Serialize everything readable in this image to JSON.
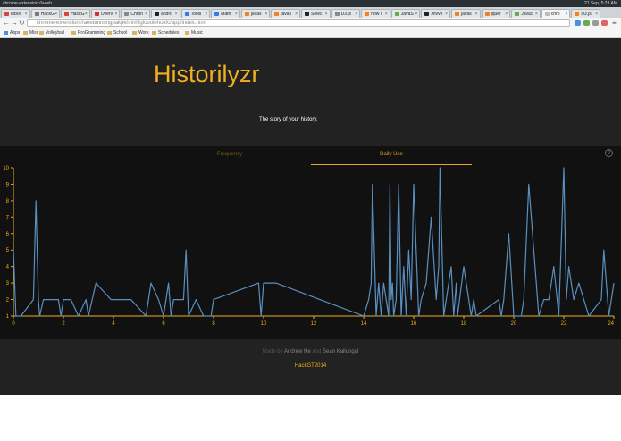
{
  "os": {
    "window_title": "chrome-extension://aeeb...",
    "clock": "21 Sep, 5:23 AM"
  },
  "browser": {
    "tabs": [
      {
        "label": "Inbox",
        "color": "#d44638",
        "active": false
      },
      {
        "label": "HackG",
        "color": "#777777",
        "active": false
      },
      {
        "label": "HackG",
        "color": "#d44638",
        "active": false
      },
      {
        "label": "Overv",
        "color": "#cc3333",
        "active": false
      },
      {
        "label": "Chron",
        "color": "#888888",
        "active": false
      },
      {
        "label": "andro",
        "color": "#222222",
        "active": false
      },
      {
        "label": "Tools",
        "color": "#3b78e7",
        "active": false
      },
      {
        "label": "Math",
        "color": "#3b78e7",
        "active": false
      },
      {
        "label": "javas",
        "color": "#f48024",
        "active": false
      },
      {
        "label": "javas",
        "color": "#f48024",
        "active": false
      },
      {
        "label": "Selec",
        "color": "#222222",
        "active": false
      },
      {
        "label": "D3.js",
        "color": "#888888",
        "active": false
      },
      {
        "label": "how i",
        "color": "#f48024",
        "active": false
      },
      {
        "label": "JavaS",
        "color": "#6aa84f",
        "active": false
      },
      {
        "label": "Jnvve",
        "color": "#222222",
        "active": false
      },
      {
        "label": "javas",
        "color": "#f48024",
        "active": false
      },
      {
        "label": "jquer",
        "color": "#f48024",
        "active": false
      },
      {
        "label": "JavaS",
        "color": "#6aa84f",
        "active": false
      },
      {
        "label": "chro",
        "color": "#bbbbbb",
        "active": true
      },
      {
        "label": "D3.js",
        "color": "#f48024",
        "active": false
      }
    ],
    "url": "chrome-extension://aeebmnnngpakpkhhhhfglooolehcofc/app/index.html",
    "bookmarks": [
      "Apps",
      "Misc",
      "Volleyball",
      "ProGramming",
      "School",
      "Work",
      "Schedules",
      "Music"
    ]
  },
  "app": {
    "title": "Historilyzr",
    "tagline": "The story of your history.",
    "tabs": {
      "frequency": "Frequency",
      "daily": "Daily Use"
    },
    "help": "?"
  },
  "footer": {
    "made_by": "Made by",
    "author1": "Andrew He",
    "and": "and",
    "author2": "Sean Kallungal",
    "event": "HackGT2014"
  },
  "chart_data": {
    "type": "line",
    "xlim": [
      0,
      24
    ],
    "ylim": [
      1,
      10
    ],
    "xticks": [
      0,
      2,
      4,
      6,
      8,
      10,
      12,
      14,
      16,
      18,
      20,
      22,
      24
    ],
    "yticks": [
      1,
      2,
      3,
      4,
      5,
      6,
      7,
      8,
      9,
      10
    ],
    "line_color": "#5a8fc0",
    "axis_color": "#f0b020",
    "x": [
      0,
      0.1,
      0.3,
      0.8,
      0.9,
      1.0,
      1.05,
      1.2,
      1.8,
      1.9,
      2.0,
      2.3,
      2.6,
      2.9,
      3.0,
      3.3,
      3.9,
      4.7,
      5.3,
      5.5,
      5.8,
      6.0,
      6.2,
      6.3,
      6.4,
      6.8,
      6.9,
      7.0,
      7.3,
      7.6,
      7.9,
      8.0,
      9.8,
      9.9,
      10.0,
      10.5,
      14.0,
      14.2,
      14.3,
      14.35,
      14.5,
      14.6,
      14.7,
      14.8,
      14.9,
      15.0,
      15.05,
      15.1,
      15.15,
      15.2,
      15.3,
      15.4,
      15.5,
      15.6,
      15.7,
      15.8,
      15.9,
      16.0,
      16.2,
      16.3,
      16.5,
      16.7,
      16.9,
      17.0,
      17.05,
      17.2,
      17.3,
      17.5,
      17.6,
      17.7,
      17.75,
      18.0,
      18.3,
      18.4,
      18.5,
      19.4,
      19.5,
      19.6,
      19.8,
      20.0,
      20.3,
      20.4,
      20.6,
      20.9,
      21.0,
      21.2,
      21.4,
      21.6,
      21.8,
      22.0,
      22.1,
      22.2,
      22.4,
      22.6,
      23.0,
      23.5,
      23.6,
      23.8,
      24.0
    ],
    "y": [
      5,
      1,
      1,
      2,
      8,
      2,
      1,
      2,
      2,
      1,
      2,
      2,
      1,
      2,
      1,
      3,
      2,
      2,
      1,
      3,
      2,
      1,
      3,
      1,
      2,
      2,
      5,
      1,
      2,
      1,
      1,
      2,
      3,
      1,
      3,
      3,
      1,
      2,
      3,
      9,
      1,
      3,
      1,
      3,
      2,
      1,
      9,
      2,
      3,
      1,
      2,
      9,
      1,
      4,
      1,
      5,
      2,
      9,
      1,
      2,
      3,
      7,
      2,
      4,
      10,
      1,
      2,
      4,
      1,
      3,
      1,
      4,
      1,
      2,
      1,
      2,
      1,
      2,
      6,
      1,
      1,
      2,
      9,
      3,
      1,
      2,
      2,
      4,
      1,
      10,
      2,
      4,
      2,
      3,
      1,
      2,
      5,
      1,
      3
    ]
  }
}
